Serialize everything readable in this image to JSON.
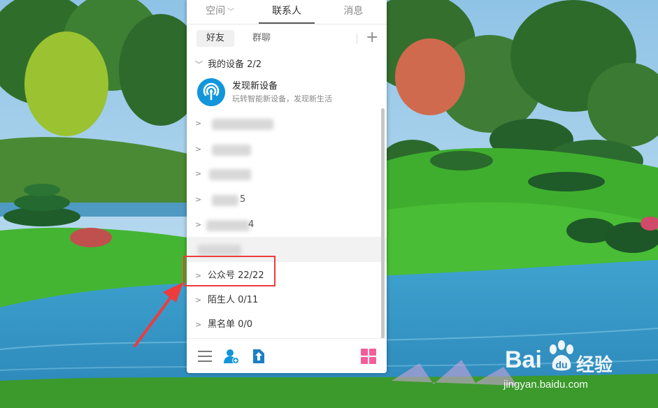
{
  "tabs": [
    {
      "label": "空间"
    },
    {
      "label": "联系人"
    },
    {
      "label": "消息"
    }
  ],
  "subtabs": {
    "friends": "好友",
    "groups": "群聊"
  },
  "groups": {
    "devices": {
      "label": "我的设备 2/2"
    },
    "public_accounts": {
      "label": "公众号 22/22"
    },
    "strangers": {
      "label": "陌生人 0/11"
    },
    "blacklist": {
      "label": "黑名单 0/0"
    }
  },
  "device_item": {
    "title": "发现新设备",
    "subtitle": "玩转智能新设备，发现新生活"
  },
  "blurred_group_suffixes": [
    "",
    "",
    "",
    "5",
    "4",
    ""
  ],
  "watermark": {
    "brand": "Bai",
    "cn": "经验",
    "url": "jingyan.baidu.com"
  },
  "colors": {
    "accent_blue": "#1296db",
    "annotation_red": "#ef3b3b",
    "tile_pink": "#f45d9a"
  }
}
